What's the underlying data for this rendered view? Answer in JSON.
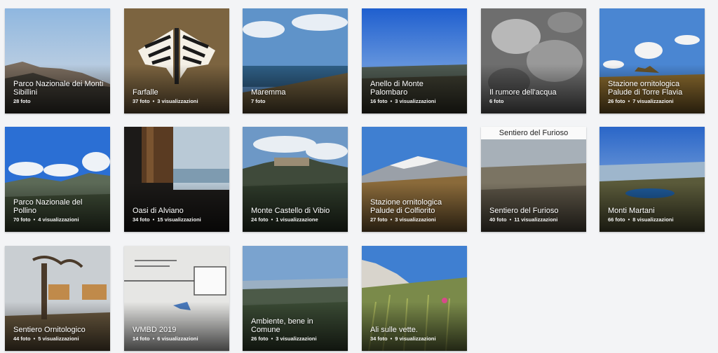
{
  "albums": [
    {
      "title": "Parco Nazionale dei Monti Sibillini",
      "photos": "28 foto",
      "views": ""
    },
    {
      "title": "Farfalle",
      "photos": "37 foto",
      "views": "3 visualizzazioni"
    },
    {
      "title": "Maremma",
      "photos": "7 foto",
      "views": ""
    },
    {
      "title": "Anello di Monte Palombaro",
      "photos": "16 foto",
      "views": "3 visualizzazioni"
    },
    {
      "title": "Il rumore dell'acqua",
      "photos": "6 foto",
      "views": ""
    },
    {
      "title": "Stazione ornitologica Palude di Torre Flavia",
      "photos": "26 foto",
      "views": "7 visualizzazioni"
    },
    {
      "title": "Parco Nazionale del Pollino",
      "photos": "70 foto",
      "views": "4 visualizzazioni"
    },
    {
      "title": "Oasi di Alviano",
      "photos": "34 foto",
      "views": "15 visualizzazioni"
    },
    {
      "title": "Monte Castello di Vibio",
      "photos": "24 foto",
      "views": "1 visualizzazione"
    },
    {
      "title": "Stazione ornitologica Palude di Colfiorito",
      "photos": "27 foto",
      "views": "3 visualizzazioni"
    },
    {
      "title": "Sentiero del Furioso",
      "photos": "40 foto",
      "views": "11 visualizzazioni",
      "banner": "Sentiero del Furioso"
    },
    {
      "title": "Monti Martani",
      "photos": "66 foto",
      "views": "8 visualizzazioni"
    },
    {
      "title": "Sentiero Ornitologico",
      "photos": "44 foto",
      "views": "5 visualizzazioni"
    },
    {
      "title": "WMBD 2019",
      "photos": "14 foto",
      "views": "6 visualizzazioni"
    },
    {
      "title": "Ambiente, bene in Comune",
      "photos": "26 foto",
      "views": "3 visualizzazioni"
    },
    {
      "title": "Ali sulle vette.",
      "photos": "34 foto",
      "views": "9 visualizzazioni"
    }
  ]
}
